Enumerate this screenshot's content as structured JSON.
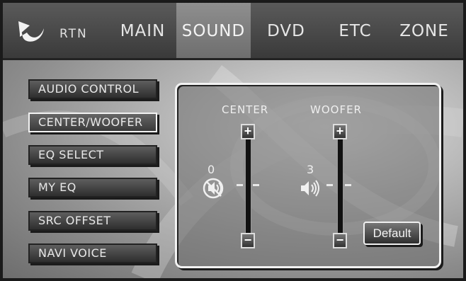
{
  "nav": {
    "rtn_label": "RTN",
    "tabs": [
      {
        "label": "MAIN",
        "active": false
      },
      {
        "label": "SOUND",
        "active": true
      },
      {
        "label": "DVD",
        "active": false
      },
      {
        "label": "ETC",
        "active": false
      },
      {
        "label": "ZONE",
        "active": false
      }
    ]
  },
  "menu": {
    "items": [
      {
        "label": "AUDIO CONTROL",
        "selected": false
      },
      {
        "label": "CENTER/WOOFER",
        "selected": true
      },
      {
        "label": "EQ SELECT",
        "selected": false
      },
      {
        "label": "MY EQ",
        "selected": false
      },
      {
        "label": "SRC OFFSET",
        "selected": false
      },
      {
        "label": "NAVI VOICE",
        "selected": false
      }
    ]
  },
  "panel": {
    "center": {
      "label": "CENTER",
      "value": "0",
      "icon": "speaker-muted-icon"
    },
    "woofer": {
      "label": "WOOFER",
      "value": "3",
      "icon": "speaker-volume-icon"
    },
    "plus_glyph": "+",
    "minus_glyph": "−",
    "default_label": "Default"
  },
  "colors": {
    "active_tab": "#7e7e7e",
    "text": "#eeeeee",
    "panel_border": "#f2f2f2"
  }
}
